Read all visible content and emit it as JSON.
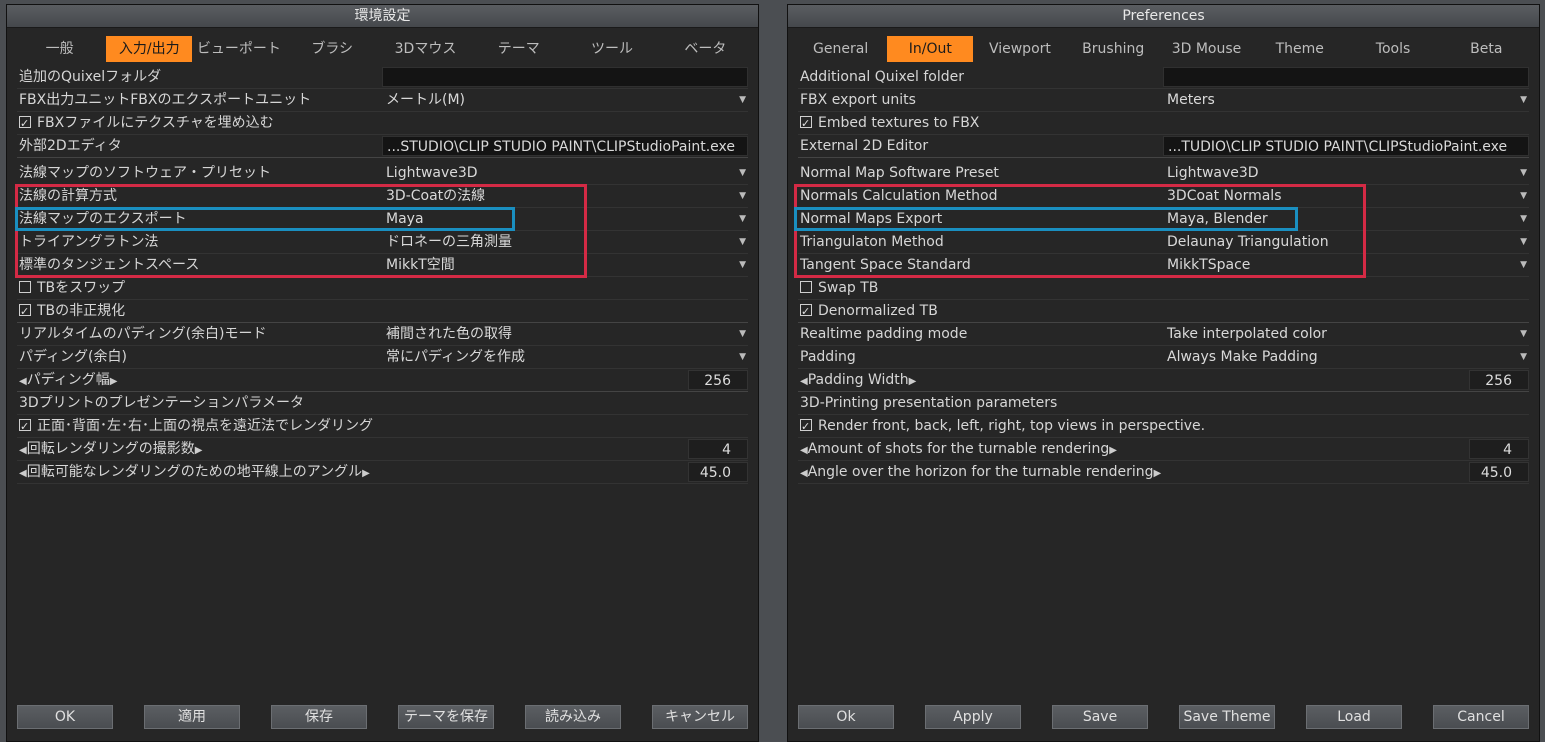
{
  "jp": {
    "title": "環境設定",
    "tabs": [
      "一般",
      "入力/出力",
      "ビューポート",
      "ブラシ",
      "3Dマウス",
      "テーマ",
      "ツール",
      "ベータ"
    ],
    "active_tab": 1,
    "rows": {
      "quixel": "追加のQuixelフォルダ",
      "quixel_value": "",
      "fbx_units": "FBX出力ユニットFBXのエクスポートユニット",
      "fbx_units_value": "メートル(M)",
      "embed": "FBXファイルにテクスチャを埋め込む",
      "editor": "外部2Dエディタ",
      "editor_value": "...STUDIO\\CLIP  STUDIO  PAINT\\CLIPStudioPaint.exe",
      "nm_preset": "法線マップのソフトウェア・プリセット",
      "nm_preset_value": "Lightwave3D",
      "normals_calc": "法線の計算方式",
      "normals_calc_value": "3D-Coatの法線",
      "nm_export": "法線マップのエクスポート",
      "nm_export_value": "Maya",
      "triangulation": "トライアングラトン法",
      "triangulation_value": "ドロネーの三角測量",
      "tangent": "標準のタンジェントスペース",
      "tangent_value": "MikkT空間",
      "swap_tb": "TBをスワップ",
      "denorm_tb": "TBの非正規化",
      "rt_padding": "リアルタイムのパディング(余白)モード",
      "rt_padding_value": "補間された色の取得",
      "padding": "パディング(余白)",
      "padding_value": "常にパディングを作成",
      "padding_width": "パディング幅",
      "padding_width_value": "256",
      "print_params": "3Dプリントのプレゼンテーションパラメータ",
      "render_views": "正面･背面･左･右･上面の視点を遠近法でレンダリング",
      "shots": "回転レンダリングの撮影数",
      "shots_value": "4",
      "angle": "回転可能なレンダリングのための地平線上のアングル",
      "angle_value": "45.0"
    },
    "buttons": {
      "ok": "OK",
      "apply": "適用",
      "save": "保存",
      "save_theme": "テーマを保存",
      "load": "読み込み",
      "cancel": "キャンセル"
    }
  },
  "en": {
    "title": "Preferences",
    "tabs": [
      "General",
      "In/Out",
      "Viewport",
      "Brushing",
      "3D Mouse",
      "Theme",
      "Tools",
      "Beta"
    ],
    "active_tab": 1,
    "rows": {
      "quixel": "Additional  Quixel  folder",
      "quixel_value": "",
      "fbx_units": "FBX  export  units",
      "fbx_units_value": "Meters",
      "embed": "Embed  textures  to  FBX",
      "editor": "External  2D  Editor",
      "editor_value": "...TUDIO\\CLIP  STUDIO  PAINT\\CLIPStudioPaint.exe",
      "nm_preset": "Normal  Map  Software  Preset",
      "nm_preset_value": "Lightwave3D",
      "normals_calc": "Normals  Calculation  Method",
      "normals_calc_value": "3DCoat  Normals",
      "nm_export": "Normal  Maps  Export",
      "nm_export_value": "Maya,  Blender",
      "triangulation": "Triangulaton  Method",
      "triangulation_value": "Delaunay  Triangulation",
      "tangent": "Tangent  Space  Standard",
      "tangent_value": "MikkTSpace",
      "swap_tb": "Swap  TB",
      "denorm_tb": "Denormalized  TB",
      "rt_padding": "Realtime  padding  mode",
      "rt_padding_value": "Take  interpolated  color",
      "padding": "Padding",
      "padding_value": "Always  Make  Padding",
      "padding_width": "Padding  Width",
      "padding_width_value": "256",
      "print_params": "3D-Printing  presentation  parameters",
      "render_views": "Render  front,  back,  left,  right,  top  views  in  perspective.",
      "shots": "Amount  of  shots  for  the  turnable  rendering",
      "shots_value": "4",
      "angle": "Angle  over  the  horizon  for  the  turnable  rendering",
      "angle_value": "45.0"
    },
    "buttons": {
      "ok": "Ok",
      "apply": "Apply",
      "save": "Save",
      "save_theme": "Save  Theme",
      "load": "Load",
      "cancel": "Cancel"
    }
  },
  "colors": {
    "accent_tab": "#ff8a1f",
    "highlight_red": "#d42a45",
    "highlight_blue": "#1a8fc0"
  },
  "checkboxes": {
    "embed": true,
    "swap_tb": false,
    "denorm_tb": true,
    "render_views": true
  }
}
